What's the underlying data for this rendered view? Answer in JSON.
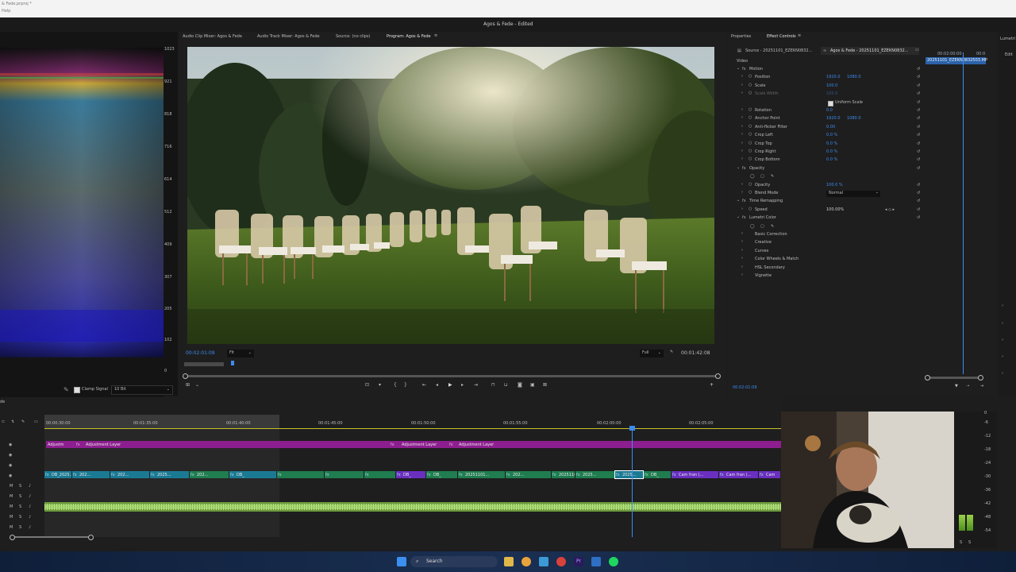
{
  "titlebar": {
    "file": "& Fede.prproj *",
    "menu": "Help"
  },
  "window_title": "Agos & Fede - Edited",
  "panel_tabs": {
    "audio_clip_mixer": "Audio Clip Mixer: Agos & Fede",
    "audio_track_mixer": "Audio Track Mixer: Agos & Fede",
    "source": "Source: (no clips)",
    "program": "Program: Agos & Fede",
    "properties": "Properties",
    "effect_controls": "Effect Controls"
  },
  "scope": {
    "scale": [
      "1023",
      "921",
      "818",
      "716",
      "614",
      "512",
      "409",
      "307",
      "205",
      "102",
      "0"
    ],
    "clamp_signal": "Clamp Signal",
    "bit_depth": "10 Bit"
  },
  "program": {
    "timecode": "00:02:01:09",
    "fit": "Fit",
    "quality": "Full",
    "duration": "00:01:42:08"
  },
  "effect_controls": {
    "source_tab": "Source - 20251101_EZEKN0832...",
    "sequence_tab": "Agos & Fede - 20251101_EZEKN0832...",
    "clip_name": "20251101_EZEKN0832503.MP",
    "mini_time": "00:02:00:00",
    "mini_time2": "00:0",
    "video_label": "Video",
    "bottom_timecode": "00:02:01:09",
    "rows": [
      {
        "label": "Motion",
        "type": "fx"
      },
      {
        "label": "Position",
        "type": "prop",
        "v1": "1920.0",
        "v2": "1080.0"
      },
      {
        "label": "Scale",
        "type": "prop",
        "v1": "100.0",
        "v2": ""
      },
      {
        "label": "Scale Width",
        "type": "prop-dim",
        "v1": "100.0",
        "v2": ""
      },
      {
        "label": "",
        "type": "check",
        "v1": "Uniform Scale",
        "v2": ""
      },
      {
        "label": "Rotation",
        "type": "prop",
        "v1": "0.0",
        "v2": ""
      },
      {
        "label": "Anchor Point",
        "type": "prop",
        "v1": "1920.0",
        "v2": "1080.0"
      },
      {
        "label": "Anti-flicker Filter",
        "type": "prop",
        "v1": "0.00",
        "v2": ""
      },
      {
        "label": "Crop Left",
        "type": "prop",
        "v1": "0.0 %",
        "v2": ""
      },
      {
        "label": "Crop Top",
        "type": "prop",
        "v1": "0.0 %",
        "v2": ""
      },
      {
        "label": "Crop Right",
        "type": "prop",
        "v1": "0.0 %",
        "v2": ""
      },
      {
        "label": "Crop Bottom",
        "type": "prop",
        "v1": "0.0 %",
        "v2": ""
      },
      {
        "label": "Opacity",
        "type": "fx"
      },
      {
        "label": "",
        "type": "masks"
      },
      {
        "label": "Opacity",
        "type": "prop",
        "v1": "100.0 %",
        "v2": ""
      },
      {
        "label": "Blend Mode",
        "type": "select",
        "v1": "Normal",
        "v2": ""
      },
      {
        "label": "Time Remapping",
        "type": "fx"
      },
      {
        "label": "Speed",
        "type": "prop-white",
        "v1": "100.00%",
        "v2": ""
      },
      {
        "label": "Lumetri Color",
        "type": "fx"
      },
      {
        "label": "",
        "type": "masks"
      },
      {
        "label": "Basic Correction",
        "type": "sub"
      },
      {
        "label": "Creative",
        "type": "sub"
      },
      {
        "label": "Curves",
        "type": "sub"
      },
      {
        "label": "Color Wheels & Match",
        "type": "sub"
      },
      {
        "label": "HSL Secondary",
        "type": "sub"
      },
      {
        "label": "Vignette",
        "type": "sub"
      }
    ]
  },
  "lumetri": {
    "tab": "Lumetri",
    "edit": "Edit"
  },
  "timeline": {
    "ruler": [
      "00:00:30:00",
      "00:01:35:00",
      "00:01:40:00",
      "00:01:45:00",
      "00:01:50:00",
      "00:01:55:00",
      "00:02:00:00",
      "00:02:05:00"
    ],
    "adjustment_clips": [
      {
        "label": "Adjustm"
      },
      {
        "label": "Adjustment Layer"
      },
      {
        "label": "Adjustment Layer"
      },
      {
        "label": "Adjustment Layer"
      }
    ],
    "video_labels": [
      "DB_2025...",
      "202...",
      "202...",
      "2025...",
      "202...",
      "DB_",
      "DB_",
      "20251101...",
      "202...",
      "20251101...",
      "2025...",
      "2025...",
      "DB_",
      "Cam fran (...",
      "Cam fran (...",
      "Cam"
    ],
    "track_letters": [
      "M",
      "S",
      "M",
      "S",
      "M",
      "S",
      "M",
      "S",
      "M",
      "S",
      "M",
      "S"
    ]
  },
  "meter_scale": [
    "0",
    "-6",
    "-12",
    "-18",
    "-24",
    "-30",
    "-36",
    "-42",
    "-48",
    "-54"
  ],
  "meter_bottom": [
    "S",
    "S"
  ],
  "taskbar": {
    "search": "Search"
  }
}
